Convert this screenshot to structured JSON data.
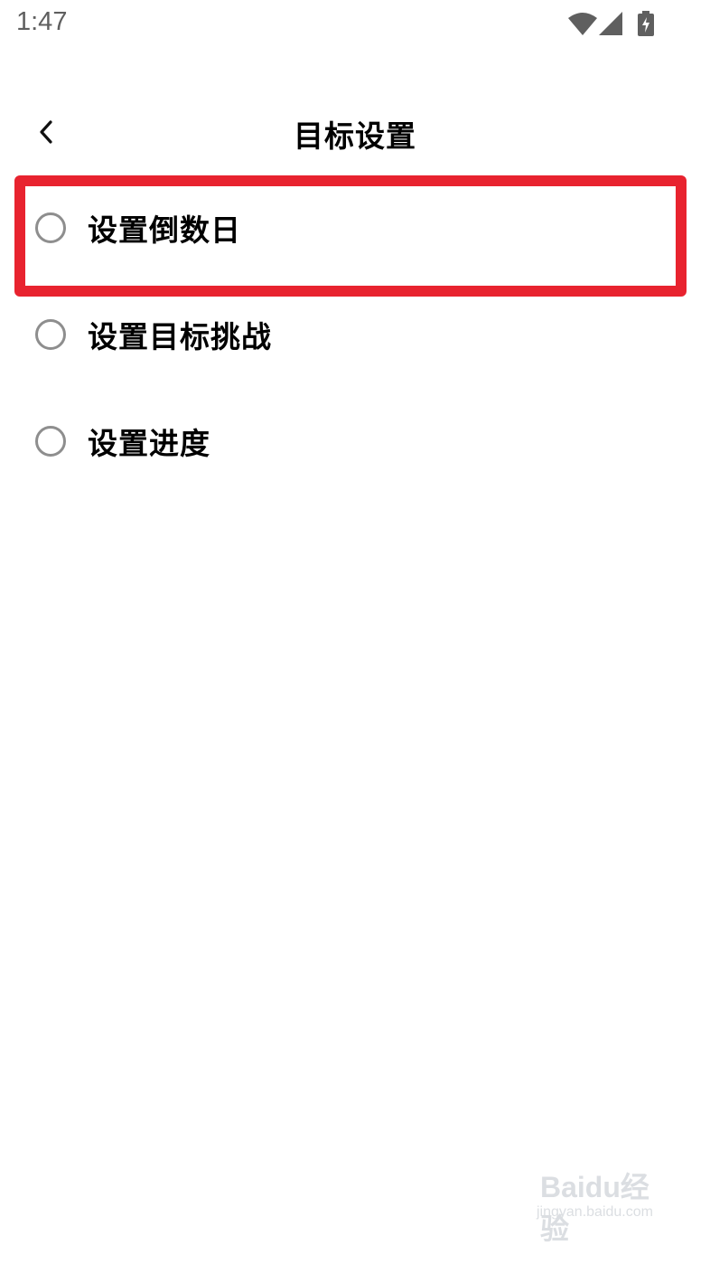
{
  "status_bar": {
    "time": "1:47",
    "icons": [
      "wifi-icon",
      "cellular-signal-icon",
      "battery-charging-icon"
    ]
  },
  "header": {
    "title": "目标设置",
    "back_icon": "chevron-left-icon"
  },
  "options": [
    {
      "label": "设置倒数日",
      "selected": false,
      "highlighted": true
    },
    {
      "label": "设置目标挑战",
      "selected": false,
      "highlighted": false
    },
    {
      "label": "设置进度",
      "selected": false,
      "highlighted": false
    }
  ],
  "annotation": {
    "highlight_color": "#e8232f"
  },
  "watermark": {
    "brand": "Baidu经验",
    "url": "jingyan.baidu.com"
  }
}
